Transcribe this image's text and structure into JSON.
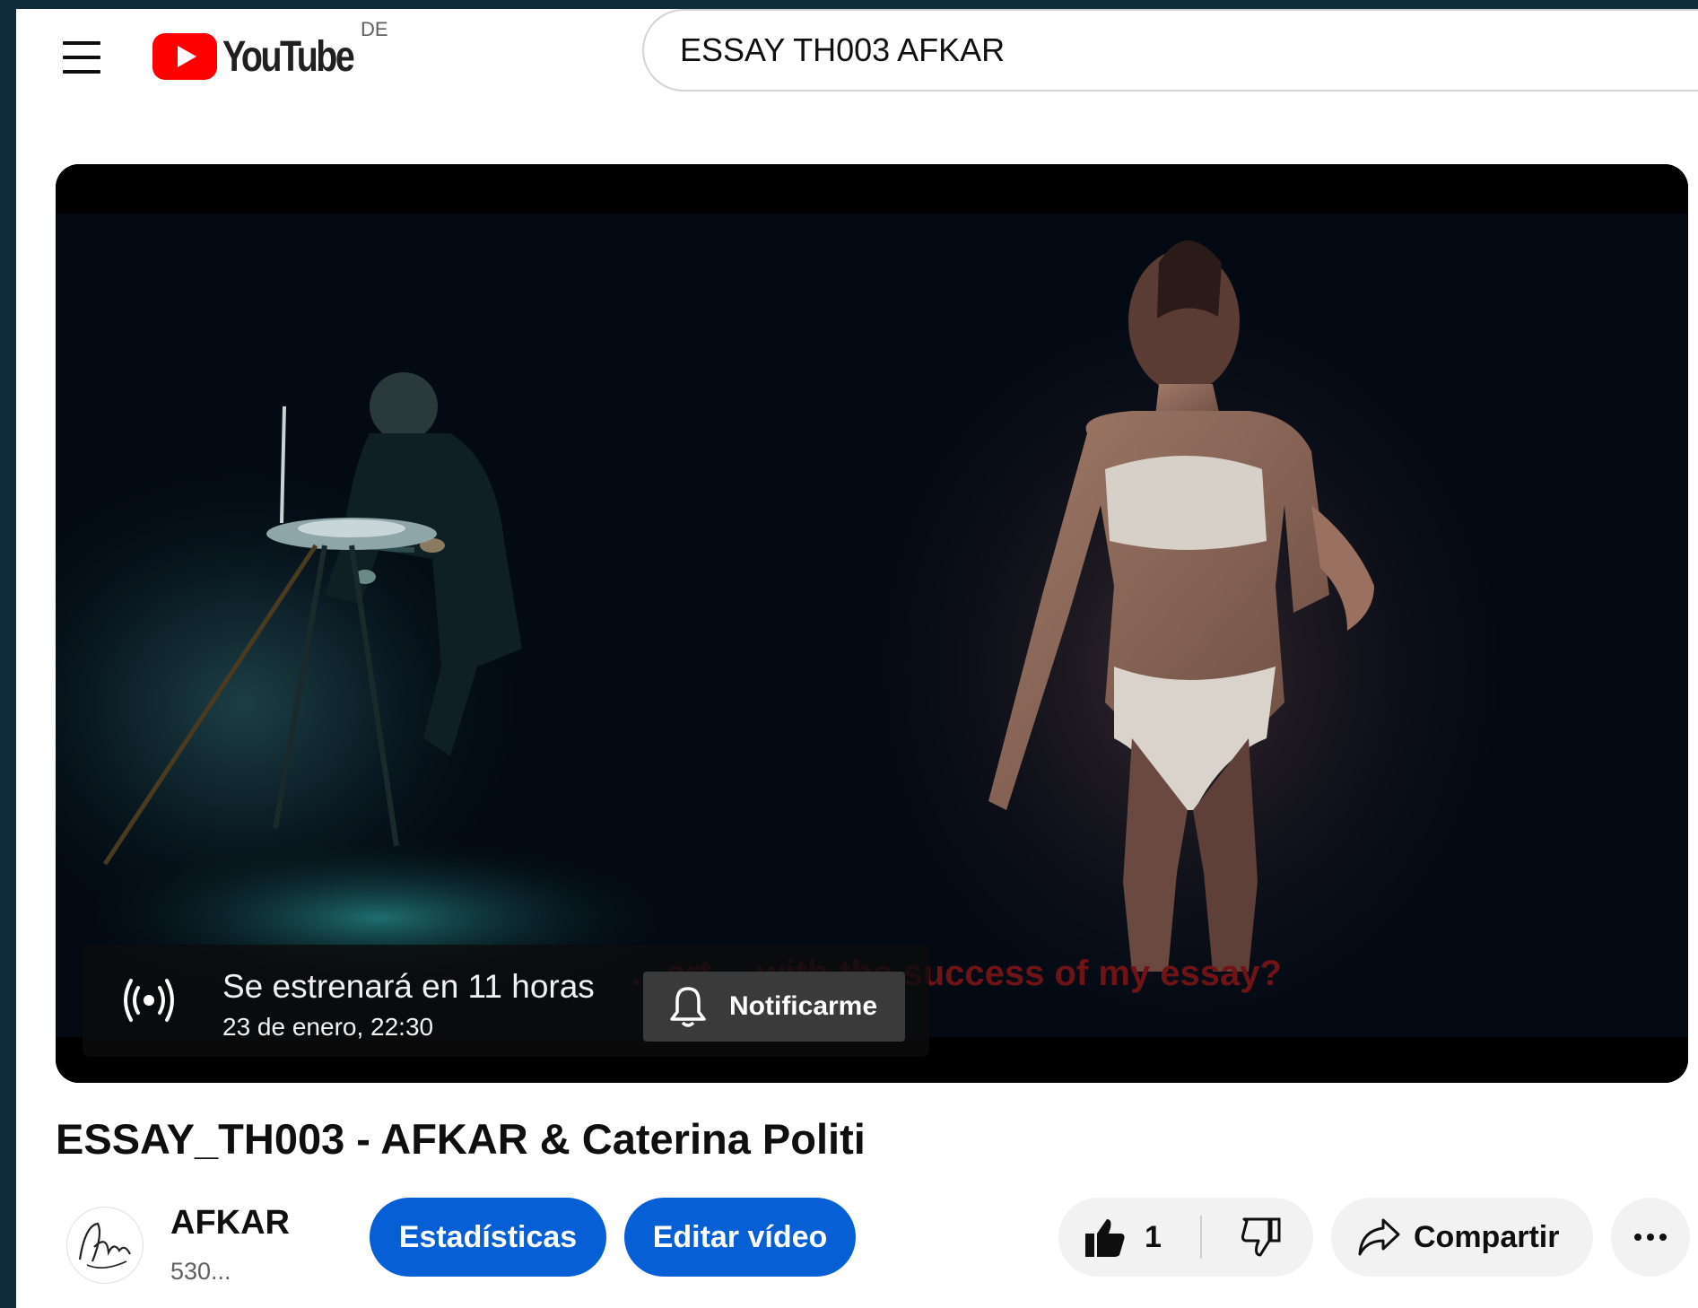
{
  "header": {
    "logo_text": "YouTube",
    "country_code": "DE",
    "search_value": "ESSAY TH003 AFKAR"
  },
  "player": {
    "subtitle": "…ert…  with the success of my essay?",
    "premiere": {
      "title": "Se estrenará en 11 horas",
      "date": "23 de enero, 22:30",
      "notify_label": "Notificarme"
    }
  },
  "video": {
    "title": "ESSAY_TH003 - AFKAR & Caterina Politi"
  },
  "channel": {
    "name": "AFKAR",
    "subscribers": "530..."
  },
  "actions": {
    "stats_label": "Estadísticas",
    "edit_label": "Editar vídeo",
    "like_count": "1",
    "share_label": "Compartir"
  },
  "colors": {
    "brand_red": "#ff0000",
    "button_blue": "#065fd4",
    "subtitle_red": "#6e1316"
  },
  "icons": [
    "menu-icon",
    "youtube-logo-icon",
    "live-broadcast-icon",
    "bell-icon",
    "thumbs-up-icon",
    "thumbs-down-icon",
    "share-arrow-icon",
    "more-icon"
  ]
}
